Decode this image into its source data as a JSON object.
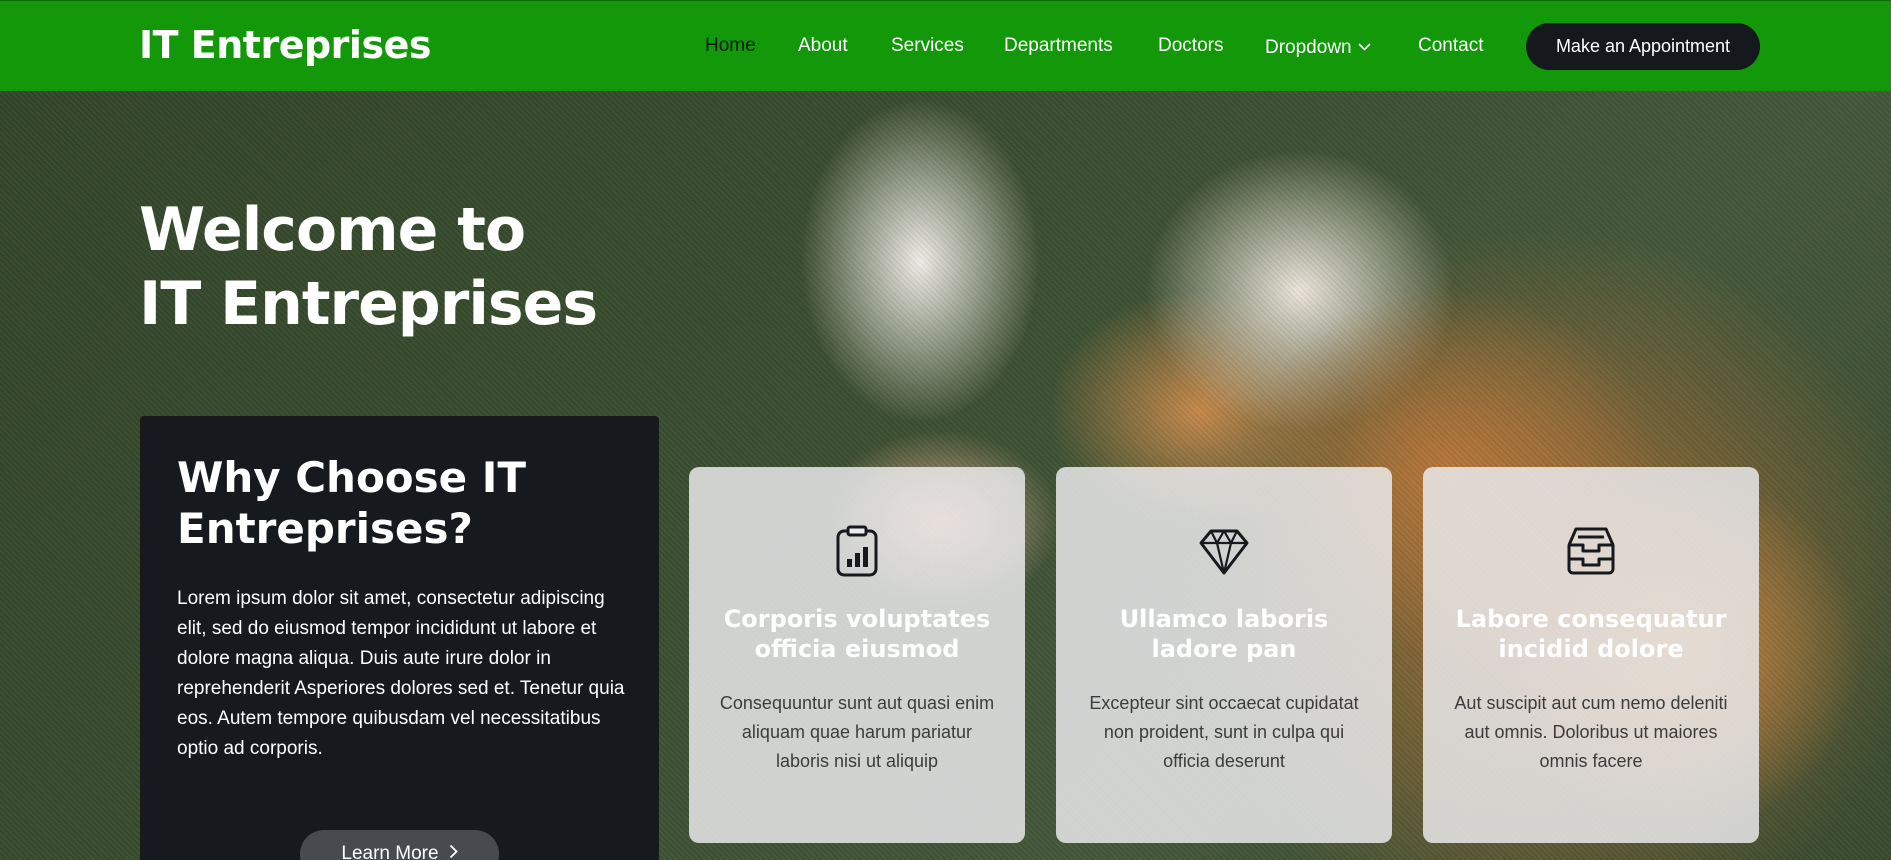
{
  "header": {
    "logo": "IT Entreprises",
    "nav": [
      {
        "label": "Home",
        "active": true
      },
      {
        "label": "About"
      },
      {
        "label": "Services"
      },
      {
        "label": "Departments"
      },
      {
        "label": "Doctors"
      },
      {
        "label": "Dropdown",
        "has_chevron": true
      },
      {
        "label": "Contact"
      }
    ],
    "cta": "Make an Appointment"
  },
  "hero": {
    "title_line1": "Welcome to",
    "title_line2": "IT Entreprises"
  },
  "why": {
    "title": "Why Choose IT Entreprises?",
    "text": "Lorem ipsum dolor sit amet, consectetur adipiscing elit, sed do eiusmod tempor incididunt ut labore et dolore magna aliqua. Duis aute irure dolor in reprehenderit Asperiores dolores sed et. Tenetur quia eos. Autem tempore quibusdam vel necessitatibus optio ad corporis.",
    "button": "Learn More"
  },
  "cards": [
    {
      "icon": "clipboard-chart-icon",
      "title": "Corporis voluptates officia eiusmod",
      "text": "Consequuntur sunt aut quasi enim aliquam quae harum pariatur laboris nisi ut aliquip"
    },
    {
      "icon": "gem-icon",
      "title": "Ullamco laboris ladore pan",
      "text": "Excepteur sint occaecat cupidatat non proident, sunt in culpa qui officia deserunt"
    },
    {
      "icon": "inbox-stack-icon",
      "title": "Labore consequatur incidid dolore",
      "text": "Aut suscipit aut cum nemo deleniti aut omnis. Doloribus ut maiores omnis facere"
    }
  ],
  "colors": {
    "header_bg": "#13980a",
    "button_dark": "#15181d",
    "panel_dark": "#16191d"
  }
}
